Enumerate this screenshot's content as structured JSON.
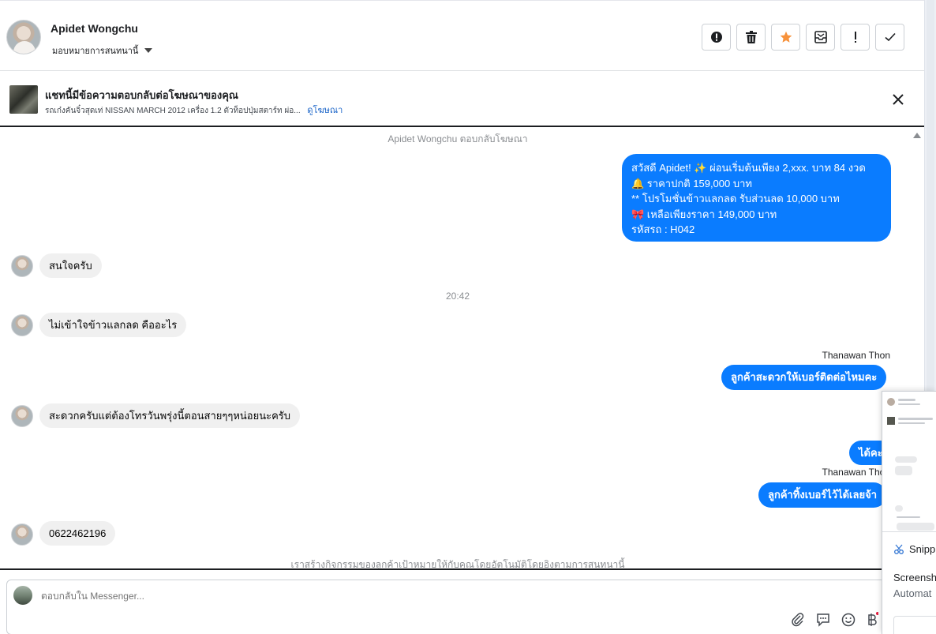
{
  "header": {
    "contact_name": "Apidet Wongchu",
    "assign_label": "มอบหมายการสนทนานี้",
    "toolbar": [
      {
        "name": "mark-spam-button",
        "icon": "alert-circle-icon"
      },
      {
        "name": "delete-button",
        "icon": "trash-icon"
      },
      {
        "name": "star-button",
        "icon": "star-icon"
      },
      {
        "name": "move-to-inbox-button",
        "icon": "inbox-envelope-icon"
      },
      {
        "name": "mark-important-button",
        "icon": "exclamation-icon"
      },
      {
        "name": "mark-done-button",
        "icon": "check-icon"
      }
    ]
  },
  "ad": {
    "title": "แชทนี้มีข้อความตอบกลับต่อโฆษณาของคุณ",
    "description": "รถเก๋งคันจิ๋วสุดเท่ NISSAN MARCH 2012 เครื่อง 1.2 ตัวท็อปปุ่มสตาร์ท ผ่อ...",
    "link": "ดูโฆษณา"
  },
  "chat": {
    "reply_notice": "Apidet Wongchu ตอบกลับโฆษณา",
    "greeting_lines": [
      "สวัสดี Apidet! ✨  ผ่อนเริ่มต้นเพียง 2,xxx. บาท 84 งวด",
      "🔔 ราคาปกติ  159,000 บาท",
      "** โปรโมชั่นข้าวแลกลด รับส่วนลด 10,000 บาท",
      "🎀  เหลือเพียงราคา 149,000 บาท",
      " รหัสรถ : H042"
    ],
    "msg_interested": "สนใจครับ",
    "time_1": "20:42",
    "msg_dont_understand": "ไม่เข้าใจข้าวแลกลด คืออะไร",
    "agent_name": "Thanawan Thon",
    "msg_ask_number": "ลูกค้าสะดวกให้เบอร์ติดต่อไหมคะ",
    "msg_call_later": "สะดวกครับแต่ต้องโทรวันพรุ่งนี้ตอนสายๆๆหน่อยนะครับ",
    "msg_ok_partial": "ได้คะ",
    "agent_name_2": "Thanawan Thon",
    "msg_leave_number": "ลูกค้าทิ้งเบอร์ไว้ได้เลยจ้า",
    "msg_phone": "0622462196",
    "footer_notice": "เราสร้างกิจกรรมของลูกค้าเป้าหมายให้กับคุณโดยอัตโนมัติโดยอิงตามการสนทนานี้"
  },
  "composer": {
    "placeholder": "ตอบกลับใน Messenger..."
  },
  "snip_overlay": {
    "app_name": "Snipp",
    "line1": "Screensh",
    "line2": "Automat"
  },
  "colors": {
    "outgoing_bubble": "#0a7cff",
    "incoming_bubble": "#f0f0f0",
    "link": "#1a64c8",
    "star": "#f7923b"
  }
}
